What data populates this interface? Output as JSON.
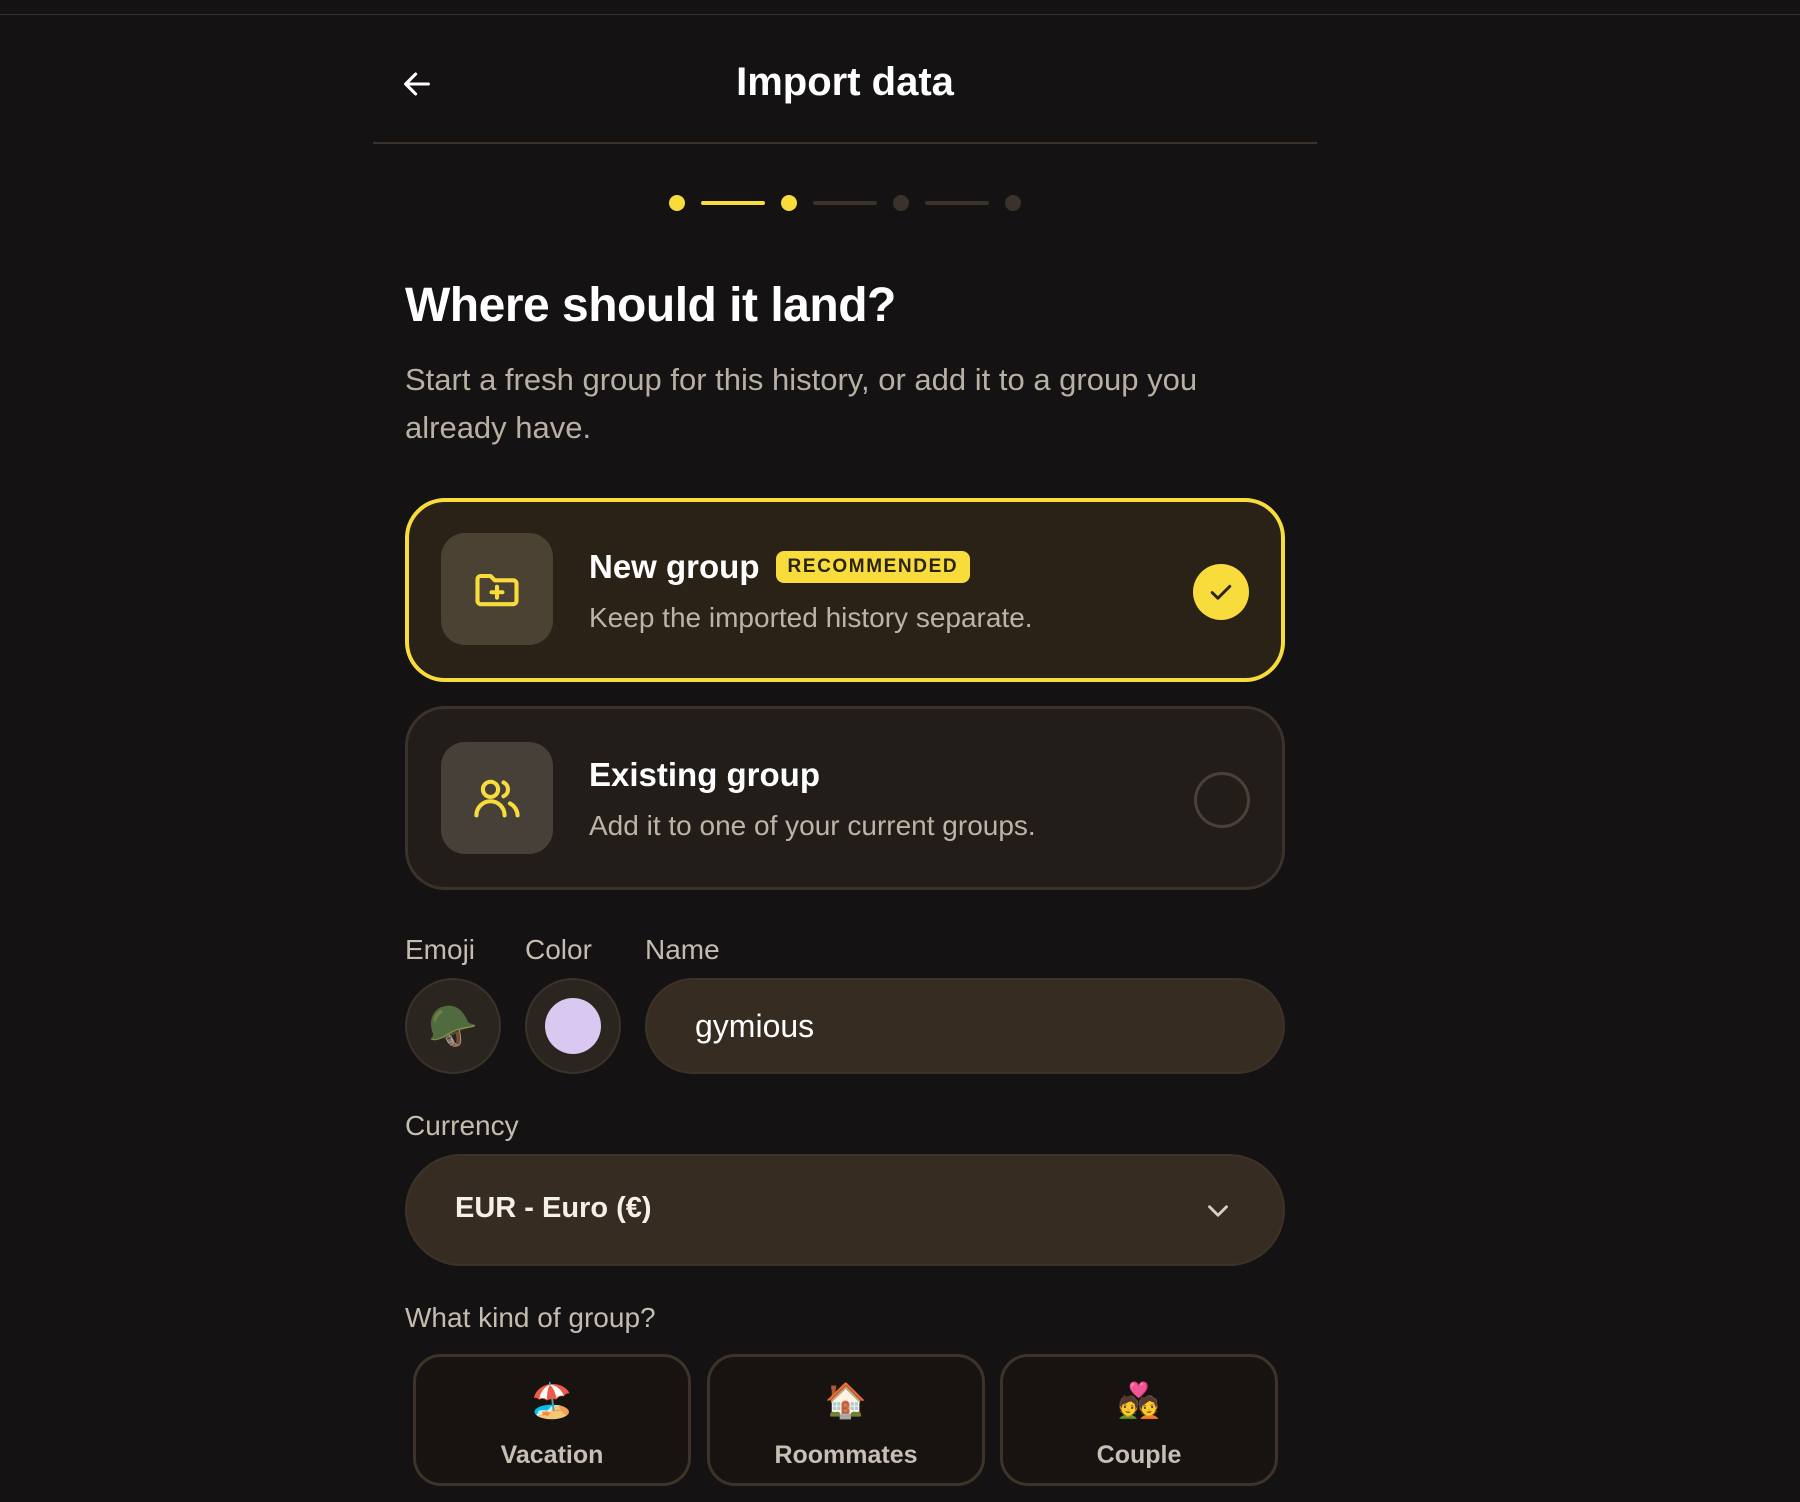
{
  "header": {
    "title": "Import data",
    "back_icon": "arrow-left-icon"
  },
  "progress": {
    "steps_total": 4,
    "current_step": 2,
    "active_color": "#f7dc3c",
    "inactive_color": "#3a322b"
  },
  "heading": "Where should it land?",
  "subheading": "Start a fresh group for this history, or add it to a group you already have.",
  "options": {
    "new_group": {
      "title": "New group",
      "badge": "RECOMMENDED",
      "description": "Keep the imported history separate.",
      "icon": "folder-plus-icon",
      "selected": true
    },
    "existing_group": {
      "title": "Existing group",
      "description": "Add it to one of your current groups.",
      "icon": "users-icon",
      "selected": false
    }
  },
  "fields": {
    "emoji_label": "Emoji",
    "emoji_value": "🪖",
    "color_label": "Color",
    "color_value": "#d9c9f0",
    "name_label": "Name",
    "name_value": "gymious",
    "currency_label": "Currency",
    "currency_value": "EUR - Euro (€)"
  },
  "kind": {
    "label": "What kind of group?",
    "options": [
      {
        "emoji": "🏖️",
        "label": "Vacation"
      },
      {
        "emoji": "🏠",
        "label": "Roommates"
      },
      {
        "emoji": "💑",
        "label": "Couple"
      }
    ]
  },
  "colors": {
    "accent": "#f7dc3c",
    "background": "#141212",
    "card": "#221d19",
    "input": "#372c22"
  }
}
